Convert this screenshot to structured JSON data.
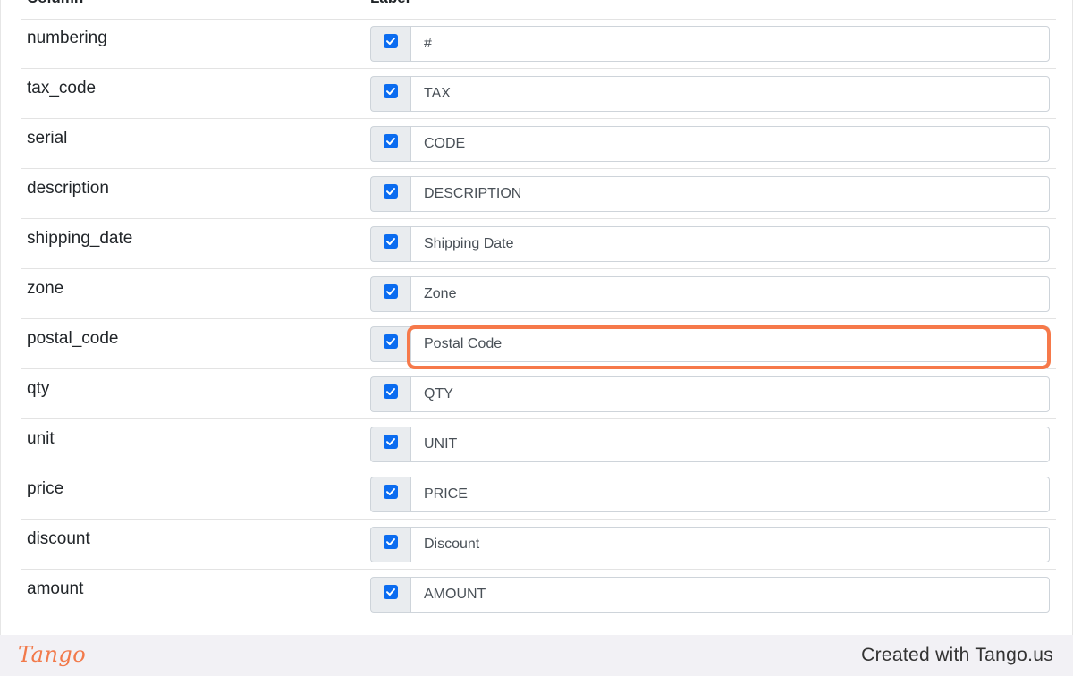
{
  "table": {
    "headers": {
      "column": "Column",
      "label": "Label"
    },
    "rows": [
      {
        "column": "numbering",
        "label": "#",
        "checked": true
      },
      {
        "column": "tax_code",
        "label": "TAX",
        "checked": true
      },
      {
        "column": "serial",
        "label": "CODE",
        "checked": true
      },
      {
        "column": "description",
        "label": "DESCRIPTION",
        "checked": true
      },
      {
        "column": "shipping_date",
        "label": "Shipping Date",
        "checked": true
      },
      {
        "column": "zone",
        "label": "Zone",
        "checked": true
      },
      {
        "column": "postal_code",
        "label": "Postal Code",
        "checked": true
      },
      {
        "column": "qty",
        "label": "QTY",
        "checked": true
      },
      {
        "column": "unit",
        "label": "UNIT",
        "checked": true
      },
      {
        "column": "price",
        "label": "PRICE",
        "checked": true
      },
      {
        "column": "discount",
        "label": "Discount",
        "checked": true
      },
      {
        "column": "amount",
        "label": "AMOUNT",
        "checked": true
      }
    ]
  },
  "highlight": {
    "target_row": "postal_code",
    "color": "#f6794a"
  },
  "footer": {
    "logo_text": "Tango",
    "credit_text": "Created with Tango.us"
  },
  "colors": {
    "checkbox": "#0b6cf0",
    "accent": "#f27a4b"
  }
}
